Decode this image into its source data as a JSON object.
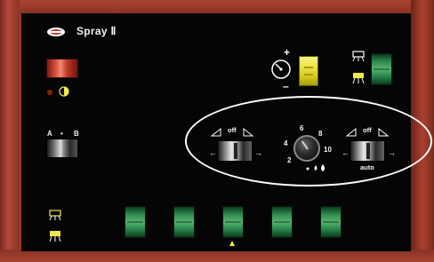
{
  "brand": {
    "title": "Spray Ⅱ",
    "logo": "oval-emblem"
  },
  "left_controls": {
    "red_switch": {
      "icon": "contrast-icon"
    },
    "ab_switch": {
      "label_a": "A",
      "label_dot": "•",
      "label_b": "B"
    }
  },
  "top_right": {
    "plus": "+",
    "minus": "–",
    "gauge_icon": "gauge-icon",
    "lamp_icon": "spray-lamp-icon"
  },
  "ellipse_group": {
    "left_rocker": {
      "top_label": "off",
      "arrow_left": "←",
      "arrow_right": "→"
    },
    "knob_scale": [
      "2",
      "4",
      "6",
      "8",
      "10"
    ],
    "right_rocker": {
      "top_label": "off",
      "bottom_label": "auto",
      "arrow_left": "←",
      "arrow_right": "→"
    }
  },
  "bottom_row": {
    "switch_count": 5,
    "marker": "▲"
  },
  "colors": {
    "frame": "#9a3a2a",
    "panel": "#050505",
    "green": "#2f8b4e",
    "yellow": "#f0e84c",
    "red": "#e0553f"
  }
}
